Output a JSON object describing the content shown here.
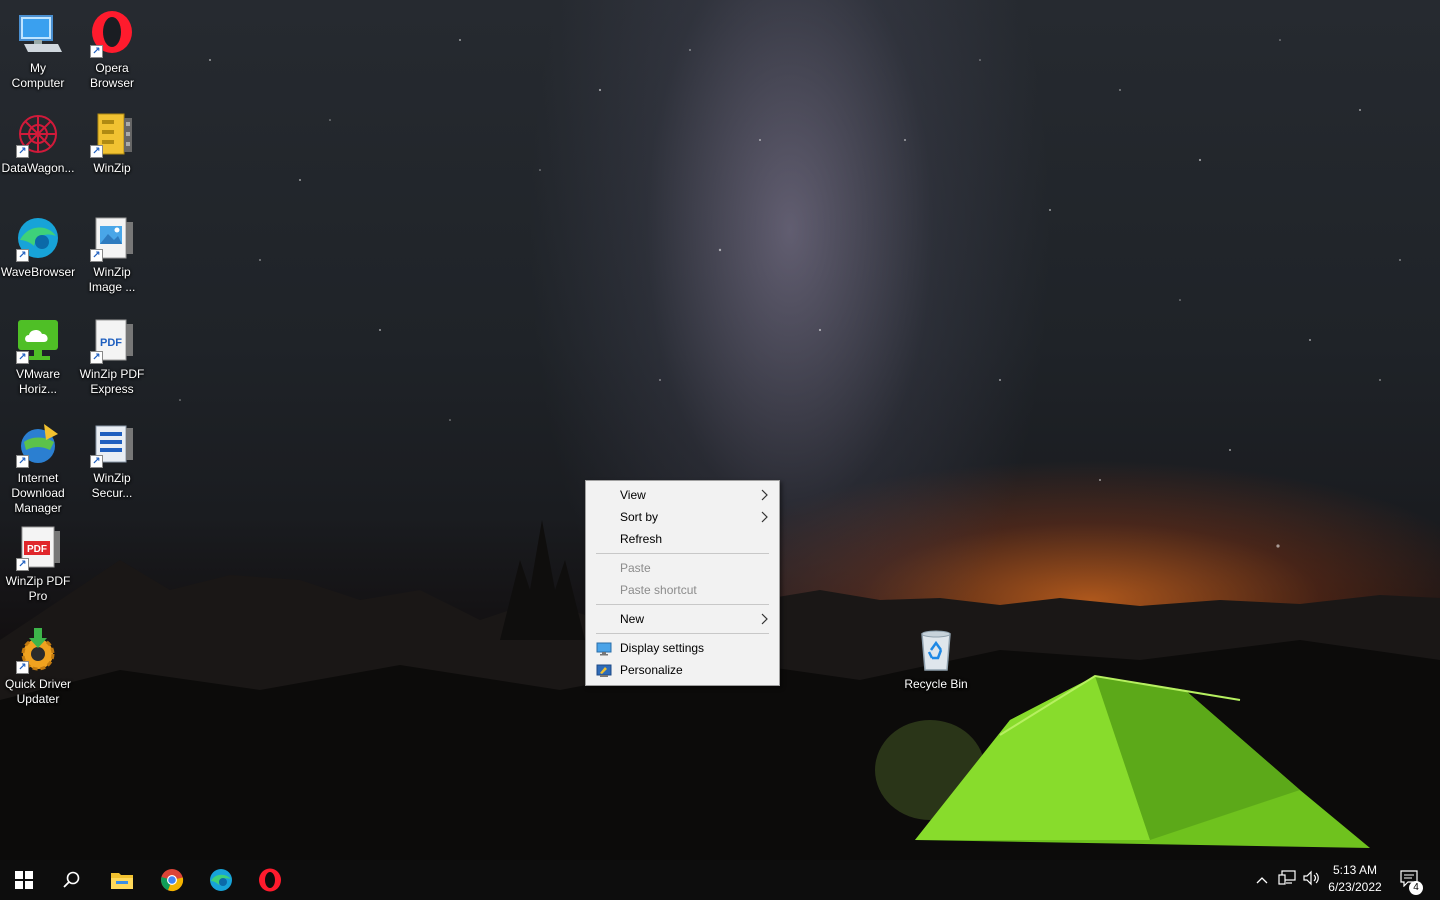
{
  "desktop_icons": [
    {
      "label": "My\nComputer",
      "icon": "my-computer-icon",
      "shortcut": false
    },
    {
      "label": "Opera\nBrowser",
      "icon": "opera-icon",
      "shortcut": true
    },
    {
      "label": "DataWagon...",
      "icon": "datawagon-icon",
      "shortcut": true
    },
    {
      "label": "WinZip",
      "icon": "winzip-icon",
      "shortcut": true
    },
    {
      "label": "WaveBrowser",
      "icon": "wavebrowser-icon",
      "shortcut": true
    },
    {
      "label": "WinZip\nImage ...",
      "icon": "winzip-image-icon",
      "shortcut": true
    },
    {
      "label": "VMware\nHoriz...",
      "icon": "vmware-horizon-icon",
      "shortcut": true
    },
    {
      "label": "WinZip PDF\nExpress",
      "icon": "winzip-pdf-express-icon",
      "shortcut": true
    },
    {
      "label": "Internet\nDownload\nManager",
      "icon": "internet-download-manager-icon",
      "shortcut": true
    },
    {
      "label": "WinZip\nSecur...",
      "icon": "winzip-secure-icon",
      "shortcut": true
    },
    {
      "label": "WinZip PDF\nPro",
      "icon": "winzip-pdf-pro-icon",
      "shortcut": true
    },
    {
      "label": "Quick Driver\nUpdater",
      "icon": "quick-driver-updater-icon",
      "shortcut": true
    },
    {
      "label": "Recycle Bin",
      "icon": "recycle-bin-icon",
      "shortcut": false
    }
  ],
  "context_menu": {
    "items": [
      {
        "label": "View",
        "has_submenu": true,
        "disabled": false
      },
      {
        "label": "Sort by",
        "has_submenu": true,
        "disabled": false
      },
      {
        "label": "Refresh",
        "has_submenu": false,
        "disabled": false
      },
      {
        "label": "Paste",
        "has_submenu": false,
        "disabled": true
      },
      {
        "label": "Paste shortcut",
        "has_submenu": false,
        "disabled": true
      },
      {
        "label": "New",
        "has_submenu": true,
        "disabled": false
      },
      {
        "label": "Display settings",
        "icon": "display-settings-icon",
        "disabled": false
      },
      {
        "label": "Personalize",
        "icon": "personalize-icon",
        "disabled": false
      }
    ]
  },
  "taskbar": {
    "pinned": [
      {
        "name": "start",
        "icon": "windows-start-icon"
      },
      {
        "name": "search",
        "icon": "search-icon"
      },
      {
        "name": "file-explorer",
        "icon": "file-explorer-icon"
      },
      {
        "name": "chrome",
        "icon": "chrome-icon"
      },
      {
        "name": "wavebrowser",
        "icon": "wavebrowser-icon"
      },
      {
        "name": "opera",
        "icon": "opera-icon"
      }
    ],
    "tray": {
      "icons": [
        "chevron-up-icon",
        "network-icon",
        "volume-icon"
      ],
      "time": "5:13 AM",
      "date": "6/23/2022",
      "notification_count": "4"
    }
  },
  "colors": {
    "taskbar_bg": "#0d0d0d",
    "menu_bg": "#f2f2f2",
    "menu_disabled_text": "#8c8c8c",
    "tent_green": "#7ed321"
  }
}
